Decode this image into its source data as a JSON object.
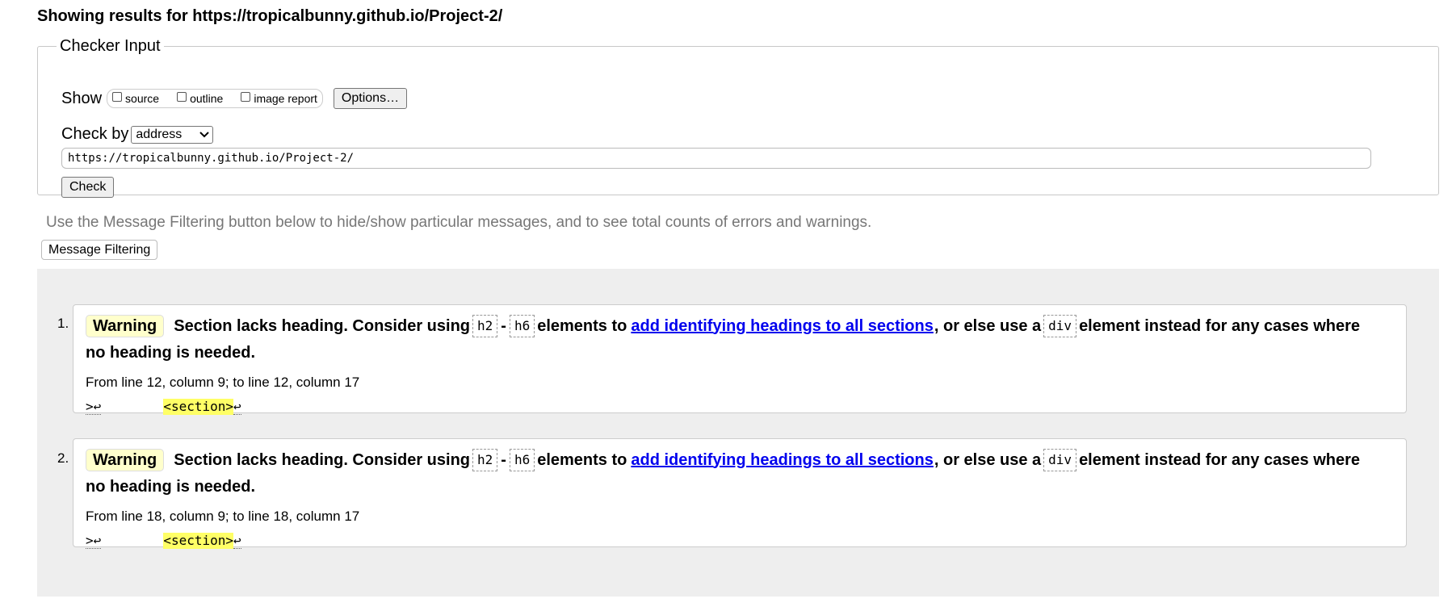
{
  "header": {
    "title": "Showing results for https://tropicalbunny.github.io/Project-2/"
  },
  "checker_input": {
    "legend": "Checker Input",
    "show_label": "Show",
    "options": [
      {
        "label": "source",
        "checked": false
      },
      {
        "label": "outline",
        "checked": false
      },
      {
        "label": "image report",
        "checked": false
      }
    ],
    "options_button": "Options…",
    "check_by_label": "Check by",
    "check_by_value": "address",
    "url_value": "https://tropicalbunny.github.io/Project-2/",
    "check_button": "Check"
  },
  "filter": {
    "hint": "Use the Message Filtering button below to hide/show particular messages, and to see total counts of errors and warnings.",
    "button": "Message Filtering"
  },
  "messages": [
    {
      "number": "1.",
      "type": "Warning",
      "text_a": "Section lacks heading. Consider using",
      "code_h2": "h2",
      "dash": "-",
      "code_h6": "h6",
      "text_b": "elements to",
      "link": "add identifying headings to all sections",
      "text_c": ", or else use a",
      "code_div": "div",
      "text_d": "element instead for any cases where",
      "text_e": "no heading is needed.",
      "location": "From line 12, column 9; to line 12, column 17",
      "extract_pre": ">↩",
      "extract_spacing": "        ",
      "extract_hl": "<section>",
      "extract_post": "↩"
    },
    {
      "number": "2.",
      "type": "Warning",
      "text_a": "Section lacks heading. Consider using",
      "code_h2": "h2",
      "dash": "-",
      "code_h6": "h6",
      "text_b": "elements to",
      "link": "add identifying headings to all sections",
      "text_c": ", or else use a",
      "code_div": "div",
      "text_d": "element instead for any cases where",
      "text_e": "no heading is needed.",
      "location": "From line 18, column 9; to line 18, column 17",
      "extract_pre": ">↩",
      "extract_spacing": "        ",
      "extract_hl": "<section>",
      "extract_post": "↩"
    }
  ]
}
